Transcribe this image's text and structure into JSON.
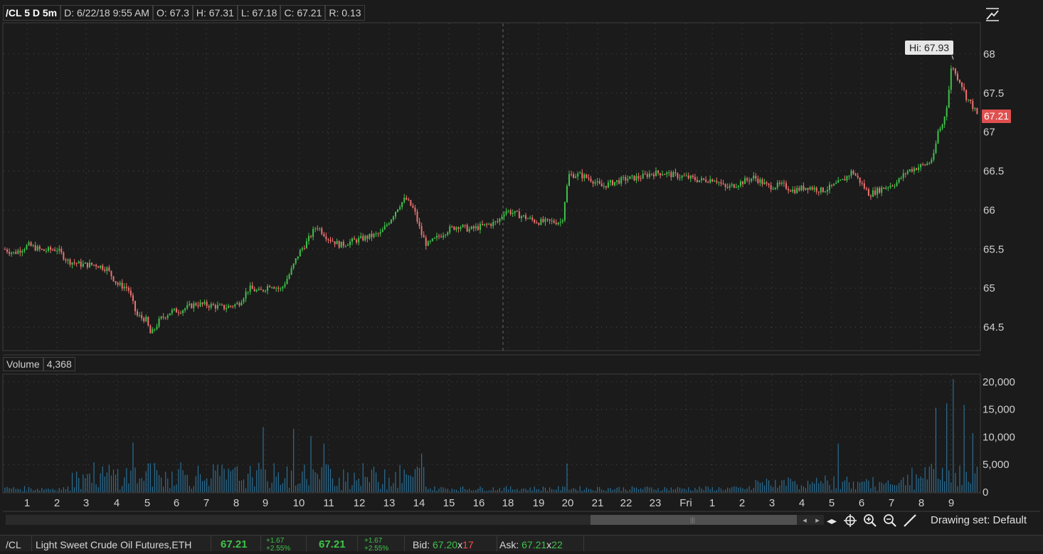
{
  "header": {
    "symbol": "/CL 5 D 5m",
    "date": "D: 6/22/18 9:55 AM",
    "open": "O: 67.3",
    "high": "H: 67.31",
    "low": "L: 67.18",
    "close": "C: 67.21",
    "range": "R: 0.13"
  },
  "price_axis": {
    "ticks": [
      "68",
      "67.5",
      "67",
      "66.5",
      "66",
      "65.5",
      "65",
      "64.5"
    ],
    "hi_label": "Hi: 67.93",
    "last_price": "67.21"
  },
  "volume_panel": {
    "label": "Volume",
    "value": "4,368",
    "ticks": [
      "20,000",
      "15,000",
      "10,000",
      "5,000",
      "0"
    ]
  },
  "time_axis": {
    "labels": [
      "1",
      "2",
      "3",
      "4",
      "5",
      "6",
      "7",
      "8",
      "9",
      "10",
      "11",
      "12",
      "13",
      "14",
      "15",
      "16",
      "18",
      "19",
      "20",
      "21",
      "22",
      "23",
      "Fri",
      "1",
      "2",
      "3",
      "4",
      "5",
      "6",
      "7",
      "8",
      "9"
    ]
  },
  "toolbar": {
    "drawing_set": "Drawing set: Default",
    "thumb_grip": "|||"
  },
  "quote_bar": {
    "symbol": "/CL",
    "description": "Light Sweet Crude Oil Futures,ETH",
    "last1": "67.21",
    "change1": "+1.67",
    "pct1": "+2.55%",
    "last2": "67.21",
    "change2": "+1.67",
    "pct2": "+2.55%",
    "bid_label": "Bid:",
    "bid_price": "67.20",
    "bid_x": "x",
    "bid_size": "17",
    "ask_label": "Ask:",
    "ask_price": "67.21",
    "ask_x": "x",
    "ask_size": "22"
  },
  "colors": {
    "background": "#1b1b1b",
    "up_candle": "#3fc24a",
    "down_candle": "#f07070",
    "volume_bar": "#2a6f96",
    "grid": "#4a4a4a"
  },
  "chart_data": {
    "type": "candlestick",
    "ylim": [
      64.2,
      68.4
    ],
    "price_path": [
      [
        0,
        65.52
      ],
      [
        20,
        65.45
      ],
      [
        40,
        65.55
      ],
      [
        60,
        65.48
      ],
      [
        80,
        65.5
      ],
      [
        95,
        65.35
      ],
      [
        115,
        65.3
      ],
      [
        135,
        65.3
      ],
      [
        150,
        65.25
      ],
      [
        165,
        65.05
      ],
      [
        180,
        65.0
      ],
      [
        192,
        64.65
      ],
      [
        205,
        64.6
      ],
      [
        212,
        64.4
      ],
      [
        225,
        64.6
      ],
      [
        240,
        64.7
      ],
      [
        255,
        64.72
      ],
      [
        275,
        64.8
      ],
      [
        295,
        64.78
      ],
      [
        315,
        64.75
      ],
      [
        335,
        64.8
      ],
      [
        350,
        65.0
      ],
      [
        365,
        64.95
      ],
      [
        380,
        65.05
      ],
      [
        395,
        64.98
      ],
      [
        408,
        65.2
      ],
      [
        420,
        65.45
      ],
      [
        432,
        65.6
      ],
      [
        445,
        65.8
      ],
      [
        460,
        65.65
      ],
      [
        478,
        65.55
      ],
      [
        495,
        65.6
      ],
      [
        515,
        65.65
      ],
      [
        535,
        65.7
      ],
      [
        550,
        65.9
      ],
      [
        560,
        66.05
      ],
      [
        570,
        66.15
      ],
      [
        582,
        66.0
      ],
      [
        592,
        65.7
      ],
      [
        600,
        65.55
      ],
      [
        615,
        65.65
      ],
      [
        630,
        65.75
      ],
      [
        645,
        65.8
      ],
      [
        660,
        65.75
      ],
      [
        680,
        65.8
      ],
      [
        700,
        65.85
      ],
      [
        710,
        66.0
      ],
      [
        725,
        65.95
      ],
      [
        740,
        65.9
      ],
      [
        755,
        65.85
      ],
      [
        770,
        65.85
      ],
      [
        790,
        65.85
      ],
      [
        795,
        66.2
      ],
      [
        800,
        66.45
      ],
      [
        815,
        66.45
      ],
      [
        830,
        66.4
      ],
      [
        845,
        66.3
      ],
      [
        860,
        66.35
      ],
      [
        880,
        66.4
      ],
      [
        900,
        66.42
      ],
      [
        915,
        66.47
      ],
      [
        932,
        66.48
      ],
      [
        945,
        66.45
      ],
      [
        965,
        66.42
      ],
      [
        985,
        66.38
      ],
      [
        1005,
        66.4
      ],
      [
        1020,
        66.28
      ],
      [
        1040,
        66.35
      ],
      [
        1060,
        66.42
      ],
      [
        1080,
        66.3
      ],
      [
        1100,
        66.32
      ],
      [
        1115,
        66.25
      ],
      [
        1135,
        66.3
      ],
      [
        1155,
        66.25
      ],
      [
        1170,
        66.3
      ],
      [
        1185,
        66.38
      ],
      [
        1198,
        66.5
      ],
      [
        1210,
        66.35
      ],
      [
        1222,
        66.2
      ],
      [
        1240,
        66.28
      ],
      [
        1260,
        66.35
      ],
      [
        1275,
        66.5
      ],
      [
        1290,
        66.55
      ],
      [
        1305,
        66.6
      ],
      [
        1313,
        66.7
      ],
      [
        1318,
        67.0
      ],
      [
        1325,
        67.1
      ],
      [
        1332,
        67.4
      ],
      [
        1338,
        67.9
      ],
      [
        1342,
        67.75
      ],
      [
        1350,
        67.65
      ],
      [
        1358,
        67.45
      ],
      [
        1366,
        67.35
      ],
      [
        1374,
        67.21
      ]
    ],
    "volume_spikes": [
      [
        188,
        9000
      ],
      [
        207,
        5200
      ],
      [
        255,
        5400
      ],
      [
        371,
        11800
      ],
      [
        413,
        11500
      ],
      [
        438,
        10200
      ],
      [
        455,
        8800
      ],
      [
        592,
        7000
      ],
      [
        796,
        5200
      ],
      [
        1177,
        8800
      ],
      [
        1316,
        15300
      ],
      [
        1330,
        16100
      ],
      [
        1340,
        20500
      ],
      [
        1355,
        15800
      ],
      [
        1368,
        10700
      ]
    ]
  }
}
